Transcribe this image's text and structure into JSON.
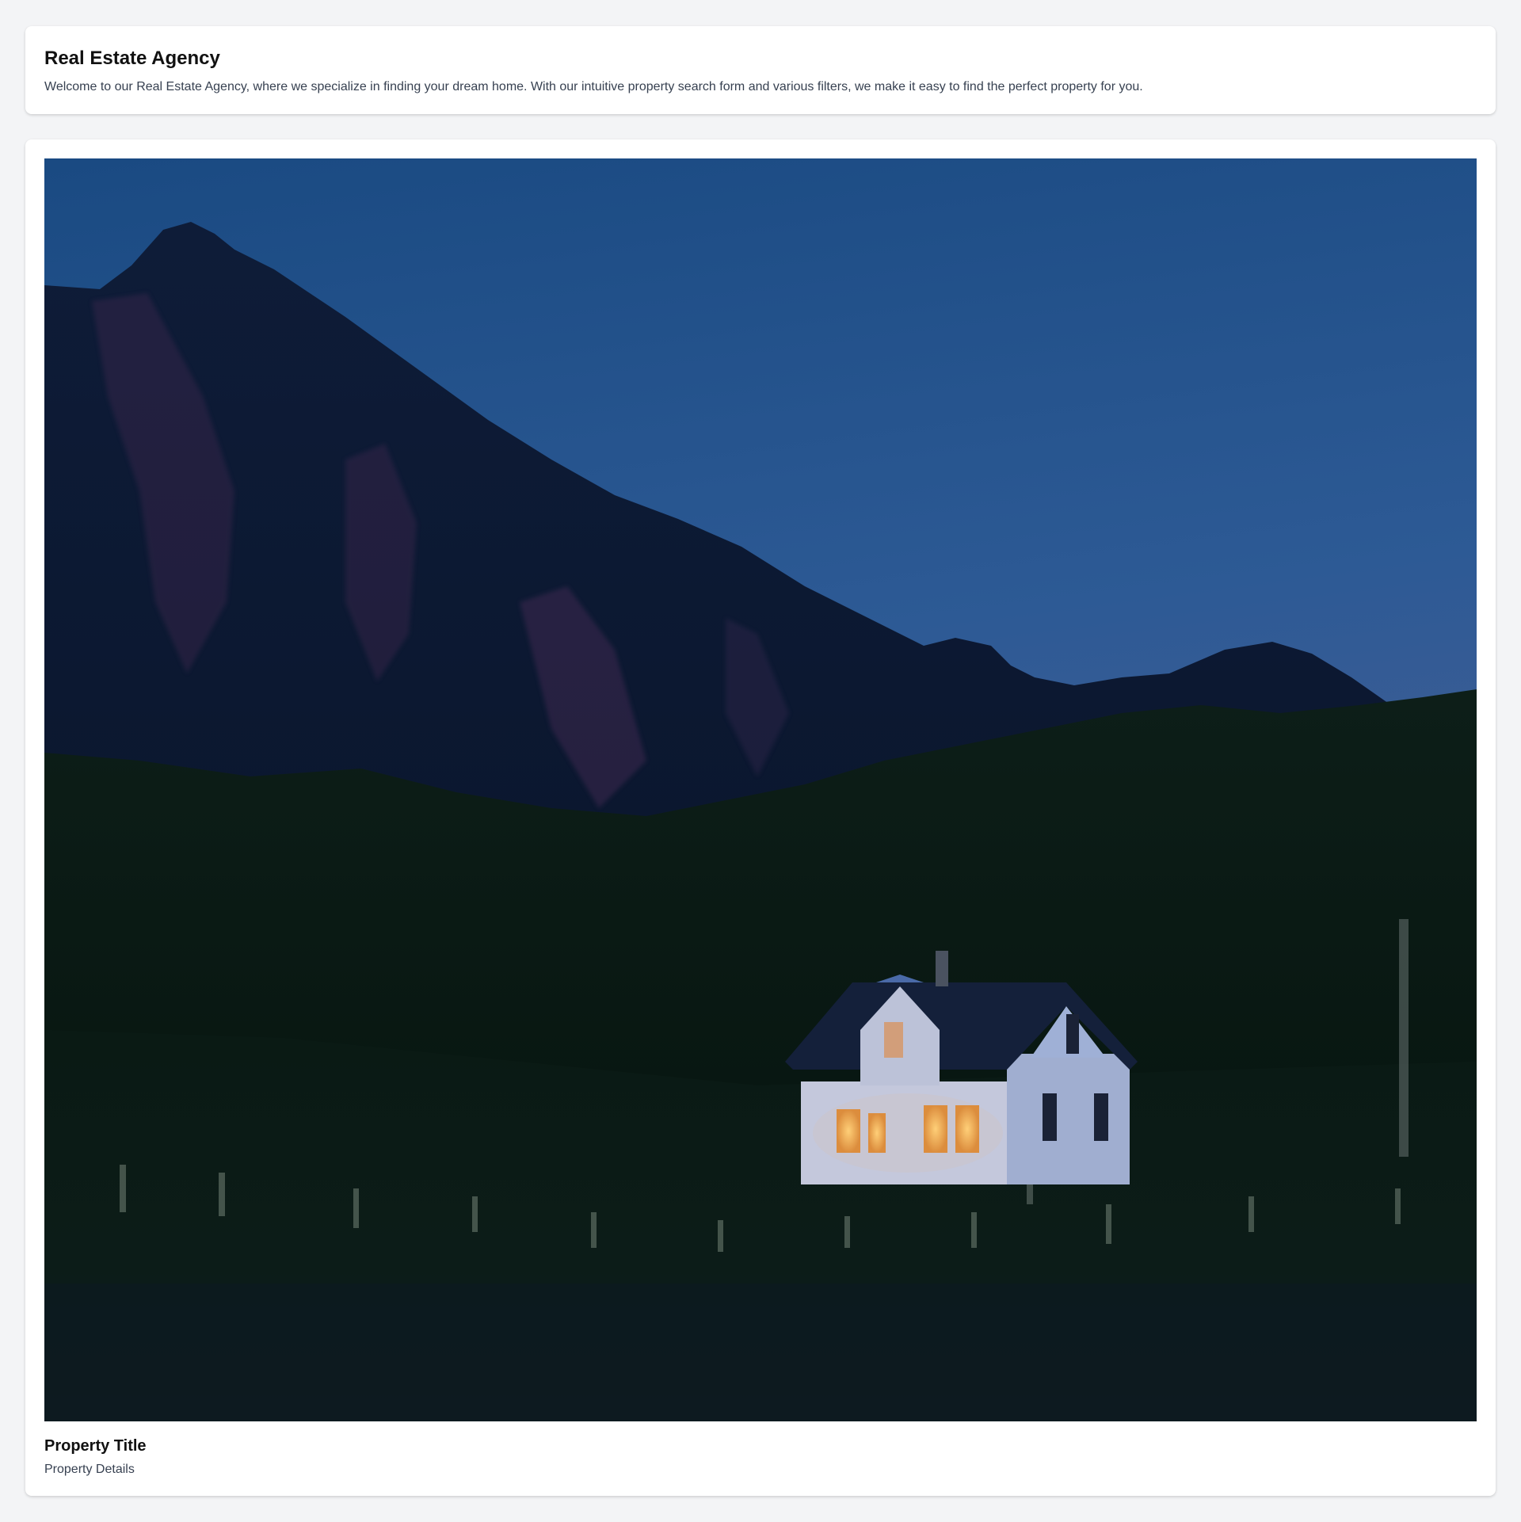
{
  "header": {
    "title": "Real Estate Agency",
    "description": "Welcome to our Real Estate Agency, where we specialize in finding your dream home. With our intuitive property search form and various filters, we make it easy to find the perfect property for you."
  },
  "property": {
    "image_alt": "house-at-dusk-photo",
    "title": "Property Title",
    "details": "Property Details"
  },
  "colors": {
    "page_background": "#f3f4f6",
    "card_background": "#ffffff",
    "title_text": "#111111",
    "body_text": "#374151"
  }
}
